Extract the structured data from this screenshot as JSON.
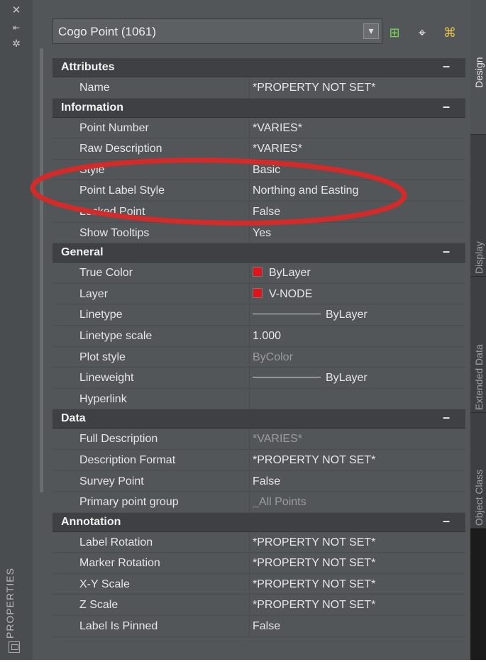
{
  "palette": {
    "title": "PROPERTIES",
    "left_icons": [
      "close-icon",
      "auto-hide-icon",
      "settings-icon"
    ]
  },
  "selector": {
    "value": "Cogo Point (1061)",
    "dropdown_icon": "dropdown-icon"
  },
  "toolbar": {
    "icons": [
      "toggle-pickadd-icon",
      "select-objects-icon",
      "quick-select-icon"
    ]
  },
  "sections": [
    {
      "title": "Attributes",
      "toggle": "–",
      "rows": [
        {
          "name": "Name",
          "value": "*PROPERTY NOT SET*"
        }
      ]
    },
    {
      "title": "Information",
      "toggle": "–",
      "rows": [
        {
          "name": "Point Number",
          "value": "*VARIES*"
        },
        {
          "name": "Raw Description",
          "value": "*VARIES*"
        },
        {
          "name": "Style",
          "value": "Basic"
        },
        {
          "name": "Point Label Style",
          "value": "Northing and Easting"
        },
        {
          "name": "Locked Point",
          "value": "False"
        },
        {
          "name": "Show Tooltips",
          "value": "Yes"
        }
      ]
    },
    {
      "title": "General",
      "toggle": "–",
      "rows": [
        {
          "name": "True Color",
          "value": "ByLayer",
          "swatch": "#e0141a"
        },
        {
          "name": "Layer",
          "value": "V-NODE",
          "swatch": "#e0141a"
        },
        {
          "name": "Linetype",
          "value": "ByLayer",
          "line": true
        },
        {
          "name": "Linetype scale",
          "value": "1.000"
        },
        {
          "name": "Plot style",
          "value": "ByColor",
          "dim": true
        },
        {
          "name": "Lineweight",
          "value": "ByLayer",
          "line": true
        },
        {
          "name": "Hyperlink",
          "value": ""
        }
      ]
    },
    {
      "title": "Data",
      "toggle": "–",
      "rows": [
        {
          "name": "Full Description",
          "value": "*VARIES*",
          "dim": true
        },
        {
          "name": "Description Format",
          "value": "*PROPERTY NOT SET*"
        },
        {
          "name": "Survey Point",
          "value": "False"
        },
        {
          "name": "Primary point group",
          "value": "_All Points",
          "dim": true
        }
      ]
    },
    {
      "title": "Annotation",
      "toggle": "–",
      "rows": [
        {
          "name": "Label Rotation",
          "value": "*PROPERTY NOT SET*"
        },
        {
          "name": "Marker Rotation",
          "value": "*PROPERTY NOT SET*"
        },
        {
          "name": "X-Y Scale",
          "value": "*PROPERTY NOT SET*"
        },
        {
          "name": "Z Scale",
          "value": "*PROPERTY NOT SET*"
        },
        {
          "name": "Label Is Pinned",
          "value": "False"
        }
      ]
    }
  ],
  "tabs": [
    {
      "label": "Design",
      "active": true
    },
    {
      "label": "Display",
      "active": false
    },
    {
      "label": "Extended Data",
      "active": false
    },
    {
      "label": "Object Class",
      "active": false
    }
  ],
  "annotation": {
    "color": "#d42a2a"
  }
}
